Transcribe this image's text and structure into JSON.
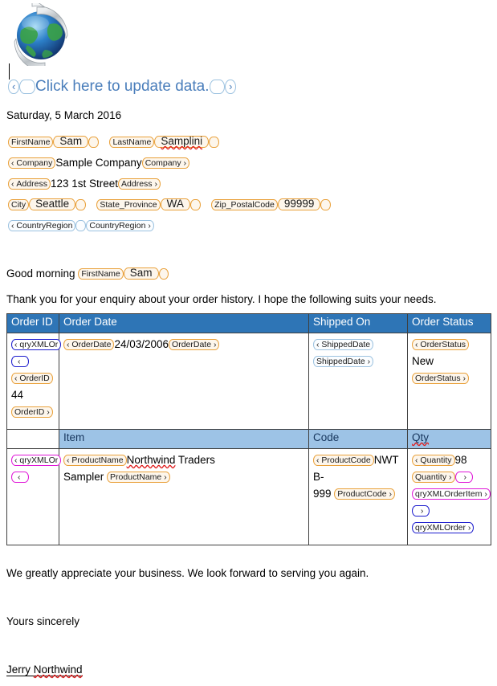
{
  "document": {
    "logo_icon": "globe-refresh-icon",
    "update_link": {
      "open_tag": "",
      "label": "Click here to update data.",
      "close_tag": ""
    },
    "date_line": "Saturday, 5 March 2016",
    "greeting_text": "Good morning",
    "body_intro": "Thank you for your enquiry about your order history. I hope the following suits your needs.",
    "closing_line": "We greatly appreciate your business. We look forward to serving you again.",
    "signoff": "Yours sincerely",
    "signature_first": "Jerry ",
    "signature_last": "Northwind"
  },
  "address_block": {
    "first_name": {
      "tag": "FirstName",
      "value": "Sam"
    },
    "last_name": {
      "tag": "LastName",
      "value": "Samplini"
    },
    "company": {
      "tag": "Company",
      "value": "Sample Company"
    },
    "address": {
      "tag": "Address",
      "value": "123 1st Street"
    },
    "city": {
      "tag": "City",
      "value": "Seattle"
    },
    "state_province": {
      "tag": "State_Province",
      "value": "WA"
    },
    "zip_postal_code": {
      "tag": "Zip_PostalCode",
      "value": "99999"
    },
    "country_region": {
      "tag": "CountryRegion",
      "value": ""
    }
  },
  "greeting_field": {
    "tag": "FirstName",
    "value": "Sam"
  },
  "table": {
    "header": [
      "Order ID",
      "Order Date",
      "Shipped On",
      "Order Status"
    ],
    "subheader": [
      "",
      "Item",
      "Code",
      "Qty"
    ],
    "order_row": {
      "repeat_tag": "qryXMLOr",
      "order_id": {
        "tag": "OrderID",
        "value": "44"
      },
      "order_date": {
        "tag": "OrderDate",
        "value": "24/03/2006"
      },
      "shipped_date": {
        "tag": "ShippedDate",
        "value": ""
      },
      "order_status": {
        "tag": "OrderStatus",
        "value": "New"
      }
    },
    "item_row": {
      "repeat_tag": "qryXMLOr",
      "product_name": {
        "tag": "ProductName",
        "value": "Northwind Traders Sampler"
      },
      "product_name_word1": "Northwind",
      "product_name_rest": " Traders",
      "product_name_line2": "Sampler",
      "product_code": {
        "tag": "ProductCode",
        "value_l1": "NWT",
        "value_l2": "B-",
        "value_l3": "999"
      },
      "quantity": {
        "tag": "Quantity",
        "value": "98"
      },
      "close_item_tag": "qryXMLOrderItem",
      "close_order_tag": "qryXMLOrder"
    }
  },
  "colors": {
    "header_blue": "#2e75b6",
    "subheader_blue": "#9dc3e6",
    "link_blue": "#4a7ebb",
    "tag_orange": "#e9a13b",
    "tag_blue": "#1c1ccd",
    "tag_magenta": "#e018d8",
    "tag_lightblue": "#9cc2e0",
    "spellcheck_red": "#e02020"
  }
}
